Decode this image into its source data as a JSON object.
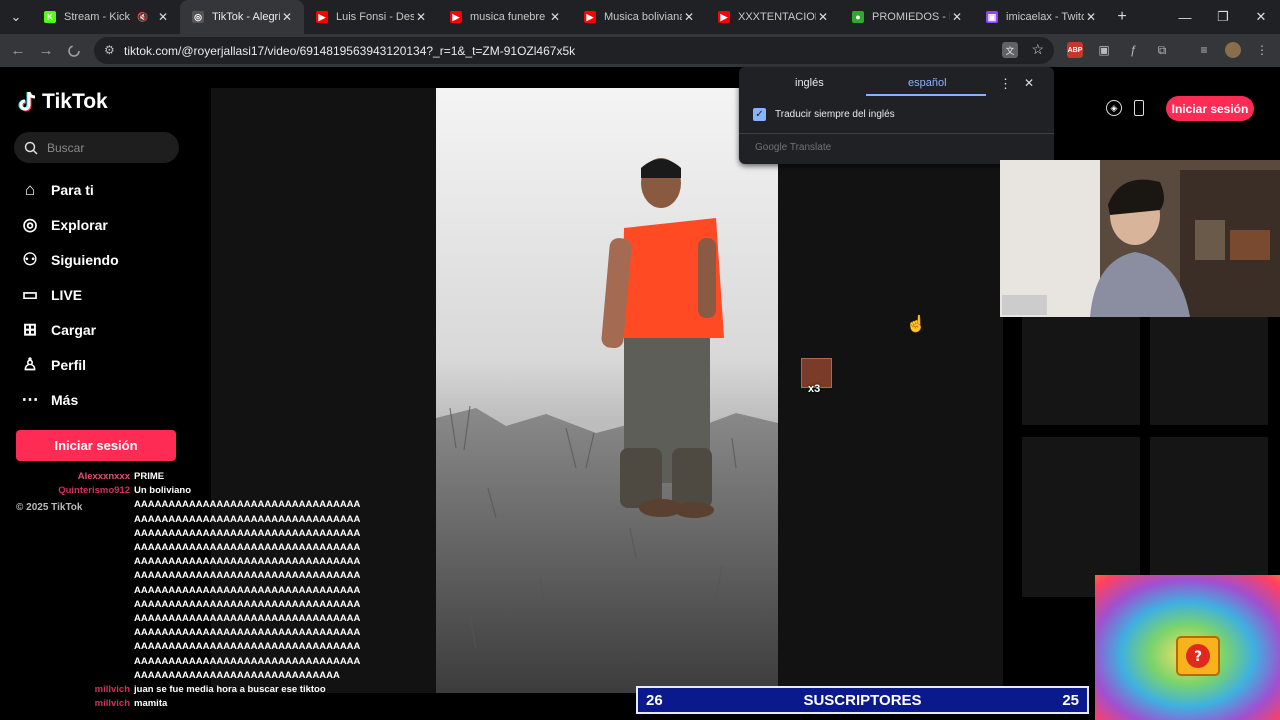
{
  "browser": {
    "tabs": [
      {
        "title": "Stream - Kick",
        "color": "#53fc18",
        "letter": "K",
        "active": false,
        "muted": true
      },
      {
        "title": "TikTok - Alegría",
        "color": "#555",
        "letter": "◎",
        "active": true,
        "muted": false
      },
      {
        "title": "Luis Fonsi - Despa",
        "color": "#ff0000",
        "letter": "▶",
        "active": false,
        "muted": false
      },
      {
        "title": "musica funebre - Y",
        "color": "#ff0000",
        "letter": "▶",
        "active": false,
        "muted": false
      },
      {
        "title": "Musica boliviana -",
        "color": "#ff0000",
        "letter": "▶",
        "active": false,
        "muted": false
      },
      {
        "title": "XXXTENTACION -",
        "color": "#ff0000",
        "letter": "▶",
        "active": false,
        "muted": false
      },
      {
        "title": "PROMIEDOS - Fut",
        "color": "#2fa82f",
        "letter": "●",
        "active": false,
        "muted": false
      },
      {
        "title": "imicaelax - Twitch",
        "color": "#9146ff",
        "letter": "▣",
        "active": false,
        "muted": false
      }
    ],
    "url": "tiktok.com/@royerjallasi17/video/6914819563943120134?_r=1&_t=ZM-91OZl467x5k"
  },
  "translate_popup": {
    "tab_source": "inglés",
    "tab_target": "español",
    "checkbox_label": "Traducir siempre del inglés",
    "checkbox_checked": true,
    "footer": "Google Translate"
  },
  "tiktok": {
    "logo_text": "TikTok",
    "search_placeholder": "Buscar",
    "nav": [
      {
        "label": "Para ti",
        "icon": "home-icon"
      },
      {
        "label": "Explorar",
        "icon": "compass-icon"
      },
      {
        "label": "Siguiendo",
        "icon": "following-icon"
      },
      {
        "label": "LIVE",
        "icon": "live-icon"
      },
      {
        "label": "Cargar",
        "icon": "upload-icon"
      },
      {
        "label": "Perfil",
        "icon": "profile-icon"
      },
      {
        "label": "Más",
        "icon": "more-icon"
      }
    ],
    "login_label": "Iniciar sesión",
    "top_login_label": "Iniciar sesión",
    "copyright": "© 2025 TikTok",
    "accent": "#fe2c55"
  },
  "chat": [
    {
      "user": "Alexxxnxxx",
      "user_color": "#e0506e",
      "text": "PRIME"
    },
    {
      "user": "Quinterismo912",
      "user_color": "#d0305a",
      "text": "Un boliviano"
    },
    {
      "user": "",
      "user_color": "#fff",
      "text": "AAAAAAAAAAAAAAAAAAAAAAAAAAAAAAAAA"
    },
    {
      "user": "",
      "user_color": "#fff",
      "text": "AAAAAAAAAAAAAAAAAAAAAAAAAAAAAAAAA"
    },
    {
      "user": "",
      "user_color": "#fff",
      "text": "AAAAAAAAAAAAAAAAAAAAAAAAAAAAAAAAA"
    },
    {
      "user": "",
      "user_color": "#fff",
      "text": "AAAAAAAAAAAAAAAAAAAAAAAAAAAAAAAAA"
    },
    {
      "user": "",
      "user_color": "#fff",
      "text": "AAAAAAAAAAAAAAAAAAAAAAAAAAAAAAAAA"
    },
    {
      "user": "",
      "user_color": "#fff",
      "text": "AAAAAAAAAAAAAAAAAAAAAAAAAAAAAAAAA"
    },
    {
      "user": "",
      "user_color": "#fff",
      "text": "AAAAAAAAAAAAAAAAAAAAAAAAAAAAAAAAA"
    },
    {
      "user": "",
      "user_color": "#fff",
      "text": "AAAAAAAAAAAAAAAAAAAAAAAAAAAAAAAAA"
    },
    {
      "user": "",
      "user_color": "#fff",
      "text": "AAAAAAAAAAAAAAAAAAAAAAAAAAAAAAAAA"
    },
    {
      "user": "",
      "user_color": "#fff",
      "text": "AAAAAAAAAAAAAAAAAAAAAAAAAAAAAAAAA"
    },
    {
      "user": "",
      "user_color": "#fff",
      "text": "AAAAAAAAAAAAAAAAAAAAAAAAAAAAAAAAA"
    },
    {
      "user": "",
      "user_color": "#fff",
      "text": "AAAAAAAAAAAAAAAAAAAAAAAAAAAAAAAAA"
    },
    {
      "user": "",
      "user_color": "#fff",
      "text": "AAAAAAAAAAAAAAAAAAAAAAAAAAAAAA"
    },
    {
      "user": "millvich",
      "user_color": "#d0305a",
      "text": "juan se fue media hora a buscar ese tiktoo"
    },
    {
      "user": "millvich",
      "user_color": "#d0305a",
      "text": "mamita"
    }
  ],
  "emote_count": "x3",
  "subs_bar": {
    "left": "26",
    "label": "SUSCRIPTORES",
    "right": "25"
  }
}
